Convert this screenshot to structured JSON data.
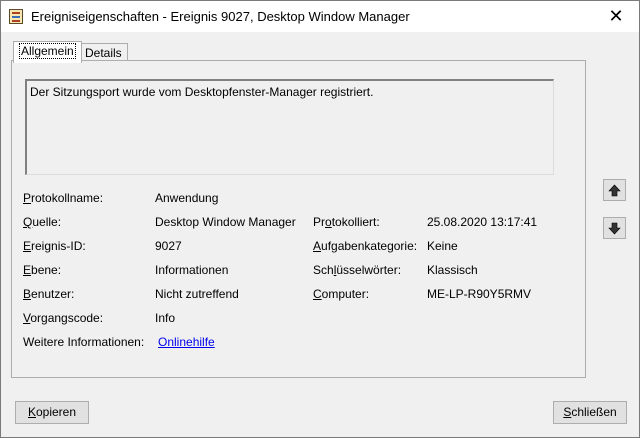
{
  "window": {
    "title": "Ereigniseigenschaften - Ereignis 9027, Desktop Window Manager",
    "close_glyph": "✕"
  },
  "tabs": [
    {
      "label": "Allgemein",
      "active": true
    },
    {
      "label": "Details",
      "active": false
    }
  ],
  "description": "Der Sitzungsport wurde vom Desktopfenster-Manager registriert.",
  "fields": {
    "protokollname": {
      "key": "P",
      "rest": "rotokollname:",
      "value": "Anwendung"
    },
    "quelle": {
      "key": "Q",
      "rest": "uelle:",
      "value": "Desktop Window Manager"
    },
    "ereignis_id": {
      "key": "E",
      "rest": "reignis-ID:",
      "value": "9027"
    },
    "ebene": {
      "key": "E",
      "rest": "bene:",
      "value": "Informationen"
    },
    "benutzer": {
      "key": "B",
      "rest": "enutzer:",
      "value": "Nicht zutreffend"
    },
    "vorgangscode": {
      "key": "V",
      "rest": "organgscode:",
      "value": "Info"
    },
    "weitere": {
      "label": "Weitere Informationen:",
      "link": "Onlinehilfe"
    },
    "protokolliert": {
      "pre": "Pr",
      "key": "o",
      "rest": "tokolliert:",
      "value": "25.08.2020 13:17:41"
    },
    "aufgabenkategorie": {
      "key": "A",
      "rest": "ufgabenkategorie:",
      "value": "Keine"
    },
    "schluesselwoerter": {
      "pre": "Sch",
      "key": "l",
      "rest": "üsselwörter:",
      "value": "Klassisch"
    },
    "computer": {
      "key": "C",
      "rest": "omputer:",
      "value": "ME-LP-R90Y5RMV"
    }
  },
  "nav": {
    "up_icon": "arrow-up-icon",
    "down_icon": "arrow-down-icon"
  },
  "buttons": {
    "copy": {
      "key": "K",
      "rest": "opieren"
    },
    "close": {
      "key": "S",
      "rest": "chließen"
    }
  }
}
